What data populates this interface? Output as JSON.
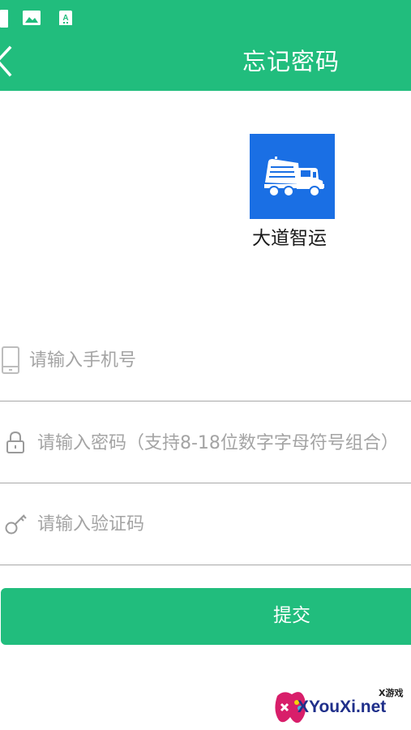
{
  "status_bar": {
    "icons": [
      "sim-card-icon",
      "image-icon",
      "storage-icon"
    ]
  },
  "header": {
    "title": "忘记密码",
    "back_icon": "chevron-left-icon"
  },
  "app": {
    "logo_icon": "truck-icon",
    "name": "大道智运",
    "logo_color": "#1a6fe4"
  },
  "form": {
    "phone_placeholder": "请输入手机号",
    "phone_value": "",
    "password_placeholder": "请输入密码（支持8-18位数字字母符号组合）",
    "password_value": "",
    "code_placeholder": "请输入验证码",
    "code_value": ""
  },
  "submit_label": "提交",
  "colors": {
    "primary": "#21bd7d",
    "placeholder": "#a4a4a4",
    "divider": "#a9a9a9"
  },
  "watermark": {
    "badge": "X游戏",
    "text": "XYouXi.net"
  }
}
